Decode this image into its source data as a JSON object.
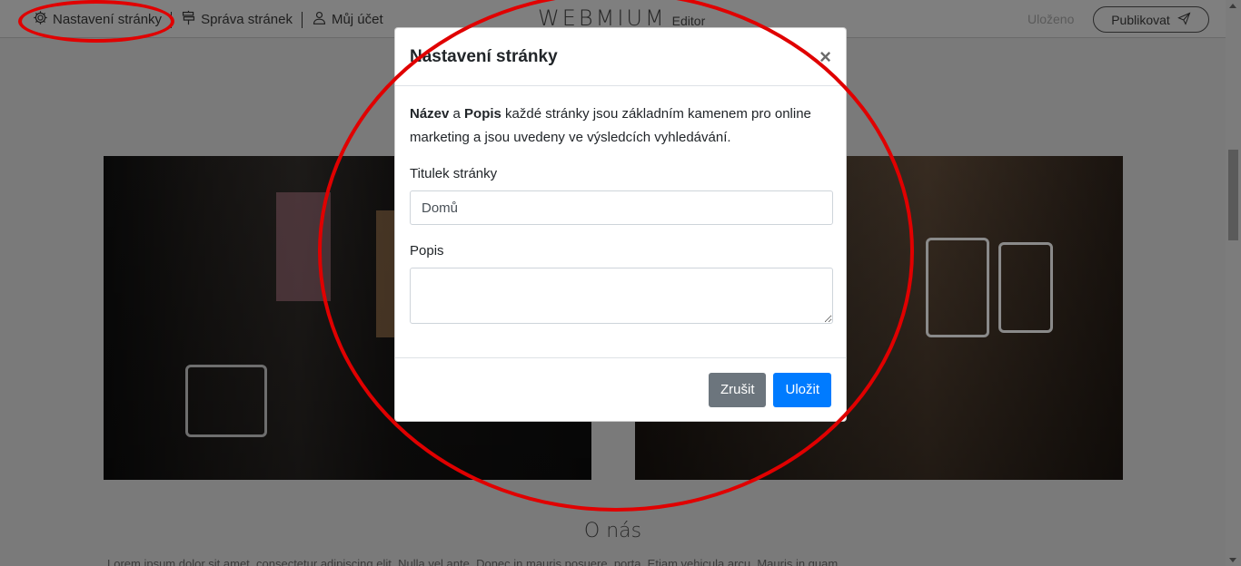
{
  "topbar": {
    "nav": [
      {
        "label": "Nastavení stránky",
        "icon": "gear-icon"
      },
      {
        "label": "Správa stránek",
        "icon": "signpost-icon"
      },
      {
        "label": "Můj účet",
        "icon": "user-icon"
      }
    ],
    "logo_word": "WEBMIUM",
    "logo_sub": "Editor",
    "status": "Uloženo",
    "publish_label": "Publikovat",
    "publish_icon": "send-icon"
  },
  "page": {
    "about_heading": "O nás",
    "about_text": "Lorem ipsum dolor sit amet, consectetur adipiscing elit. Nulla vel ante. Donec in mauris posuere, porta. Etiam vehicula arcu. Mauris in quam."
  },
  "modal": {
    "title": "Nastavení stránky",
    "close_icon": "close-icon",
    "intro_bold1": "Název",
    "intro_mid1": " a ",
    "intro_bold2": "Popis",
    "intro_rest": " každé stránky jsou základním kamenem pro online marketing a jsou uvedeny ve výsledcích vyhledávání.",
    "title_label": "Titulek stránky",
    "title_value": "Domů",
    "description_label": "Popis",
    "description_value": "",
    "cancel_label": "Zrušit",
    "save_label": "Uložit"
  },
  "colors": {
    "annotation": "#e00000",
    "primary": "#007bff",
    "secondary": "#6c757d"
  }
}
